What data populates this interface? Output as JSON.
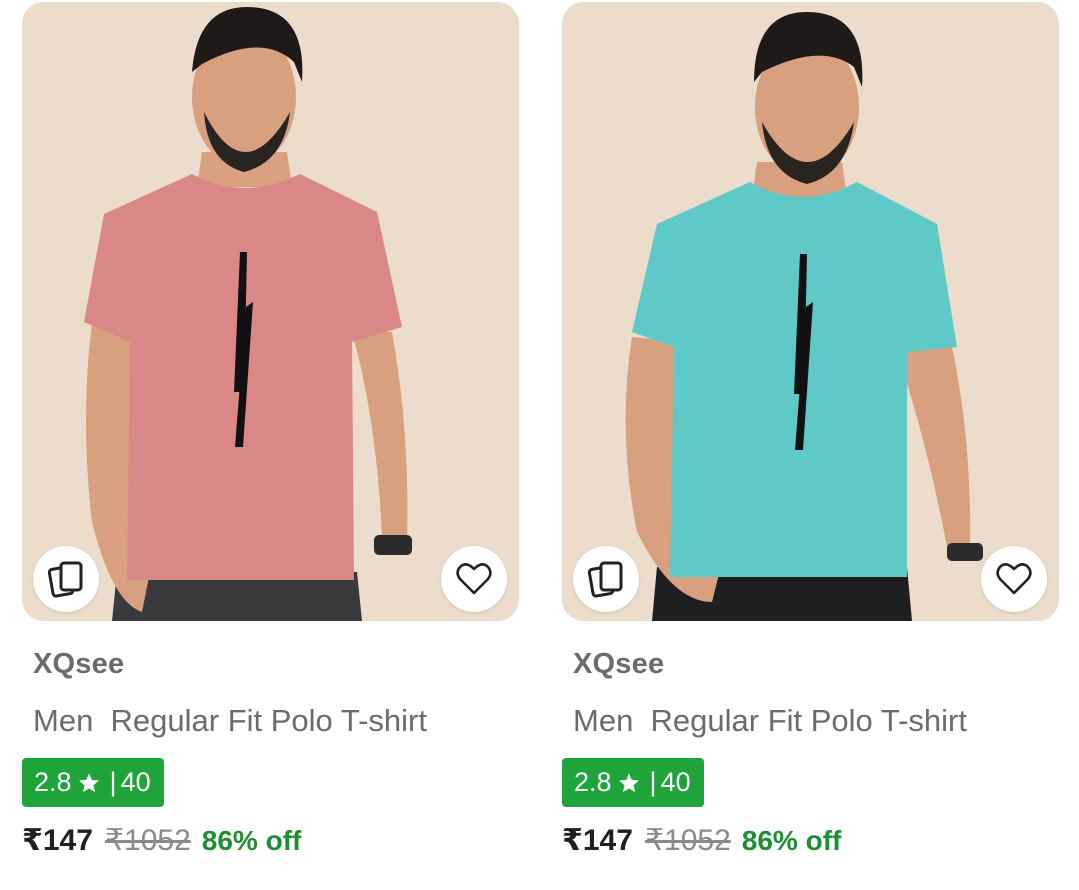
{
  "products": [
    {
      "brand": "XQsee",
      "title": "Men  Regular Fit Polo T-shirt",
      "rating": "2.8",
      "rating_count": "40",
      "price": "₹147",
      "mrp": "₹1052",
      "discount": "86% off",
      "shirt_color": "#d98787",
      "icons": {
        "similar": "similar-cards-icon",
        "wishlist": "heart-icon",
        "star": "star-icon"
      }
    },
    {
      "brand": "XQsee",
      "title": "Men  Regular Fit Polo T-shirt",
      "rating": "2.8",
      "rating_count": "40",
      "price": "₹147",
      "mrp": "₹1052",
      "discount": "86% off",
      "shirt_color": "#5ec9c7",
      "icons": {
        "similar": "similar-cards-icon",
        "wishlist": "heart-icon",
        "star": "star-icon"
      }
    }
  ],
  "colors": {
    "rating_badge": "#1ea43a",
    "discount_text": "#1e8e32",
    "image_background": "#ecdccb"
  }
}
